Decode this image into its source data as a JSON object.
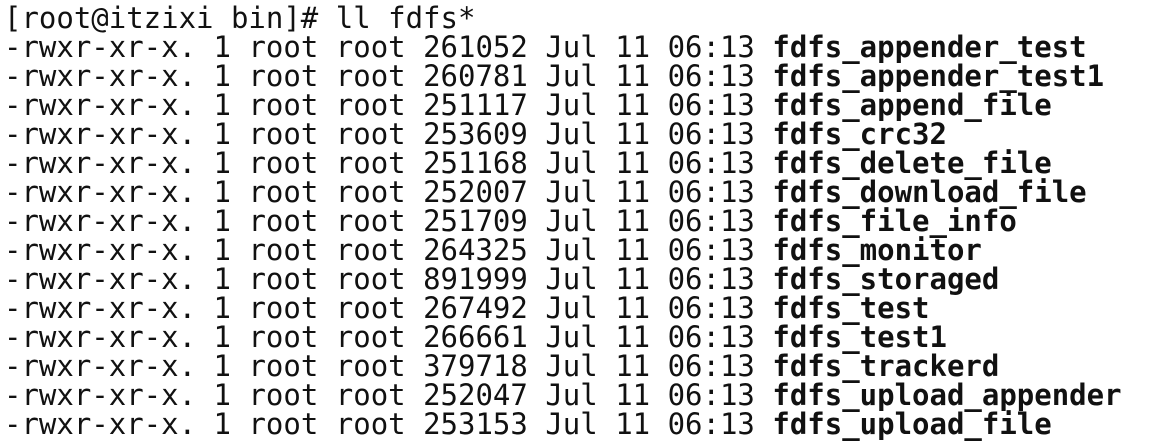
{
  "prompt": {
    "text": "[root@itzixi bin]# ",
    "command": "ll fdfs*"
  },
  "listing": [
    {
      "perms": "-rwxr-xr-x.",
      "links": "1",
      "owner": "root",
      "group": "root",
      "size": "261052",
      "month": "Jul",
      "day": "11",
      "time": "06:13",
      "name": "fdfs_appender_test"
    },
    {
      "perms": "-rwxr-xr-x.",
      "links": "1",
      "owner": "root",
      "group": "root",
      "size": "260781",
      "month": "Jul",
      "day": "11",
      "time": "06:13",
      "name": "fdfs_appender_test1"
    },
    {
      "perms": "-rwxr-xr-x.",
      "links": "1",
      "owner": "root",
      "group": "root",
      "size": "251117",
      "month": "Jul",
      "day": "11",
      "time": "06:13",
      "name": "fdfs_append_file"
    },
    {
      "perms": "-rwxr-xr-x.",
      "links": "1",
      "owner": "root",
      "group": "root",
      "size": "253609",
      "month": "Jul",
      "day": "11",
      "time": "06:13",
      "name": "fdfs_crc32"
    },
    {
      "perms": "-rwxr-xr-x.",
      "links": "1",
      "owner": "root",
      "group": "root",
      "size": "251168",
      "month": "Jul",
      "day": "11",
      "time": "06:13",
      "name": "fdfs_delete_file"
    },
    {
      "perms": "-rwxr-xr-x.",
      "links": "1",
      "owner": "root",
      "group": "root",
      "size": "252007",
      "month": "Jul",
      "day": "11",
      "time": "06:13",
      "name": "fdfs_download_file"
    },
    {
      "perms": "-rwxr-xr-x.",
      "links": "1",
      "owner": "root",
      "group": "root",
      "size": "251709",
      "month": "Jul",
      "day": "11",
      "time": "06:13",
      "name": "fdfs_file_info"
    },
    {
      "perms": "-rwxr-xr-x.",
      "links": "1",
      "owner": "root",
      "group": "root",
      "size": "264325",
      "month": "Jul",
      "day": "11",
      "time": "06:13",
      "name": "fdfs_monitor"
    },
    {
      "perms": "-rwxr-xr-x.",
      "links": "1",
      "owner": "root",
      "group": "root",
      "size": "891999",
      "month": "Jul",
      "day": "11",
      "time": "06:13",
      "name": "fdfs_storaged"
    },
    {
      "perms": "-rwxr-xr-x.",
      "links": "1",
      "owner": "root",
      "group": "root",
      "size": "267492",
      "month": "Jul",
      "day": "11",
      "time": "06:13",
      "name": "fdfs_test"
    },
    {
      "perms": "-rwxr-xr-x.",
      "links": "1",
      "owner": "root",
      "group": "root",
      "size": "266661",
      "month": "Jul",
      "day": "11",
      "time": "06:13",
      "name": "fdfs_test1"
    },
    {
      "perms": "-rwxr-xr-x.",
      "links": "1",
      "owner": "root",
      "group": "root",
      "size": "379718",
      "month": "Jul",
      "day": "11",
      "time": "06:13",
      "name": "fdfs_trackerd"
    },
    {
      "perms": "-rwxr-xr-x.",
      "links": "1",
      "owner": "root",
      "group": "root",
      "size": "252047",
      "month": "Jul",
      "day": "11",
      "time": "06:13",
      "name": "fdfs_upload_appender"
    },
    {
      "perms": "-rwxr-xr-x.",
      "links": "1",
      "owner": "root",
      "group": "root",
      "size": "253153",
      "month": "Jul",
      "day": "11",
      "time": "06:13",
      "name": "fdfs_upload_file"
    }
  ]
}
